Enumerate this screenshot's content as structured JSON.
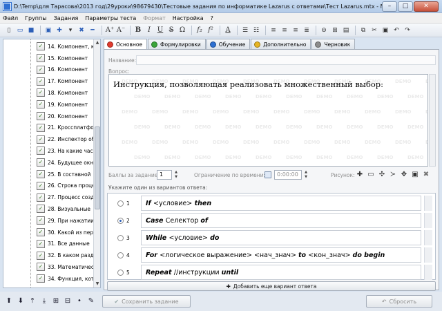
{
  "window": {
    "title": "D:\\Temp\\для Тарасова\\2013 год\\29уроки\\98679430\\Тестовые задания по информатике Lazarus с ответами\\Тест Lazarus.mtx - MyTestEdit...",
    "minimize": "–",
    "maximize": "□",
    "close": "✕"
  },
  "menu": [
    {
      "label": "Файл",
      "disabled": false
    },
    {
      "label": "Группы",
      "disabled": false
    },
    {
      "label": "Задания",
      "disabled": false
    },
    {
      "label": "Параметры теста",
      "disabled": false
    },
    {
      "label": "Формат",
      "disabled": true
    },
    {
      "label": "Настройка",
      "disabled": false
    },
    {
      "label": "?",
      "disabled": false
    }
  ],
  "toolbar": {
    "font_up": "A⁺",
    "font_down": "A⁻",
    "bold": "B",
    "italic": "I",
    "underline": "U",
    "strike": "S",
    "omega": "Ω",
    "sub": "f₂",
    "sup": "f²",
    "color": "A"
  },
  "sidebar": {
    "items": [
      "14. Компонент, к",
      "15. Компонент",
      "16. Компонент",
      "17. Компонент",
      "18. Компонент",
      "19. Компонент",
      "20. Компонент",
      "21. Кроссплатфо",
      "22. Инспектор об",
      "23. На какие час",
      "24. Будущее окн",
      "25. В составной",
      "26. Строка проце",
      "27. Процесс созд",
      "28. Визуальные",
      "29. При нажатии",
      "30. Какой из пер",
      "31. Все данные",
      "32. В каком разд",
      "33. Математичес",
      "34. Функция, кото"
    ]
  },
  "bottom": {
    "save_label": "Сохранить задание",
    "reset_label": "Сбросить"
  },
  "tabs": [
    {
      "label": "Основное",
      "color": "#e03b2e",
      "active": true
    },
    {
      "label": "Формулировки",
      "color": "#3aa53a",
      "active": false
    },
    {
      "label": "Обучение",
      "color": "#2c6fd1",
      "active": false
    },
    {
      "label": "Дополнительно",
      "color": "#e6b422",
      "active": false
    },
    {
      "label": "Черновик",
      "color": "#8c8c8c",
      "active": false
    }
  ],
  "form": {
    "name_label": "Название:",
    "question_label": "Вопрос:",
    "question_text": "Инструкция, позволяющая реализовать множественный выбор:",
    "watermark": "DEMO",
    "points_label": "Баллы за задание:",
    "points_value": "1",
    "time_label": "Ограничение по времени:",
    "time_value": "0:00:00",
    "picture_label": "Рисунок:",
    "answers_hint": "Укажите один из вариантов ответа:",
    "add_answer": "Добавить еще вариант ответа"
  },
  "answers": [
    {
      "num": "1",
      "selected": false,
      "parts": [
        [
          "If ",
          "kw"
        ],
        [
          "<условие>",
          "n"
        ],
        [
          " then",
          "kw"
        ]
      ]
    },
    {
      "num": "2",
      "selected": true,
      "parts": [
        [
          "Case ",
          "kw"
        ],
        [
          "Селектор ",
          "n"
        ],
        [
          "of",
          "kw"
        ]
      ]
    },
    {
      "num": "3",
      "selected": false,
      "parts": [
        [
          "While ",
          "kw"
        ],
        [
          "<условие>",
          "n"
        ],
        [
          " do",
          "kw"
        ]
      ]
    },
    {
      "num": "4",
      "selected": false,
      "parts": [
        [
          "For ",
          "kw"
        ],
        [
          "<логическое выражение> <нач_знач> ",
          "n"
        ],
        [
          "to ",
          "kw"
        ],
        [
          "<кон_знач> ",
          "n"
        ],
        [
          "do begin",
          "kw"
        ]
      ]
    },
    {
      "num": "5",
      "selected": false,
      "parts": [
        [
          "Repeat ",
          "kw"
        ],
        [
          "//инструкции ",
          "n"
        ],
        [
          "until",
          "kw"
        ]
      ]
    }
  ]
}
